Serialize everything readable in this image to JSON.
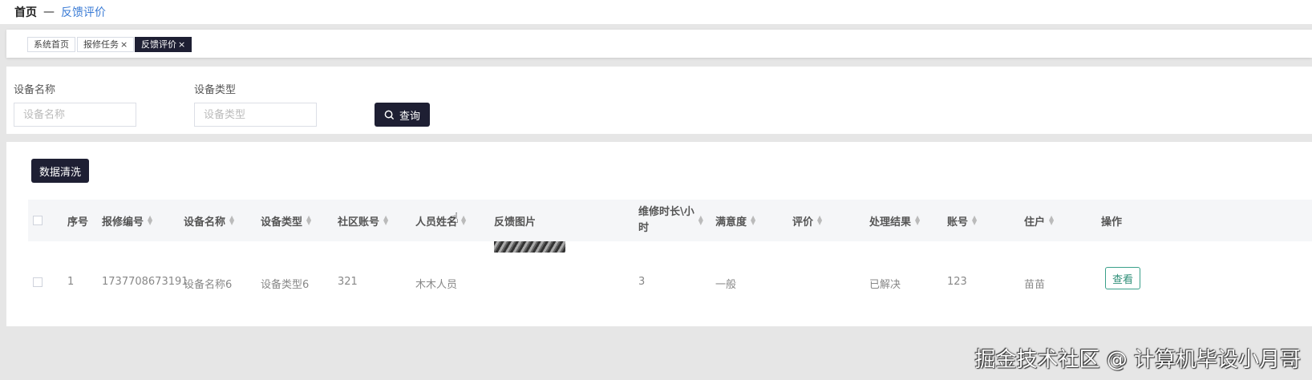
{
  "breadcrumb": {
    "home": "首页",
    "separator": "—",
    "current": "反馈评价"
  },
  "tags": [
    {
      "label": "系统首页",
      "closable": false,
      "active": false
    },
    {
      "label": "报修任务",
      "closable": true,
      "active": false
    },
    {
      "label": "反馈评价",
      "closable": true,
      "active": true
    }
  ],
  "tag_close_glyph": "×",
  "search": {
    "device_name_label": "设备名称",
    "device_name_placeholder": "设备名称",
    "device_type_label": "设备类型",
    "device_type_placeholder": "设备类型",
    "query_label": "查询"
  },
  "toolbar": {
    "clean_label": "数据清洗"
  },
  "table": {
    "columns": [
      "序号",
      "报修编号",
      "设备名称",
      "设备类型",
      "社区账号",
      "人员姓名",
      "反馈图片",
      "维修时长\\小",
      "时",
      "满意度",
      "评价",
      "处理结果",
      "账号",
      "住户",
      "操作"
    ],
    "rows": [
      {
        "index": "1",
        "repair_no": "1737708673191",
        "device_name": "设备名称6",
        "device_type": "设备类型6",
        "community_account": "321",
        "staff_name": "木木人员",
        "repair_hours": "3",
        "satisfaction": "一般",
        "evaluation": "",
        "result": "已解决",
        "account": "123",
        "resident": "苗苗",
        "action_label": "查看"
      }
    ]
  },
  "watermark": "掘金技术社区 @ 计算机毕设小月哥",
  "colors": {
    "primary_dark": "#1e1f33",
    "link_blue": "#3a7bd5",
    "view_green": "#2f8f78"
  }
}
